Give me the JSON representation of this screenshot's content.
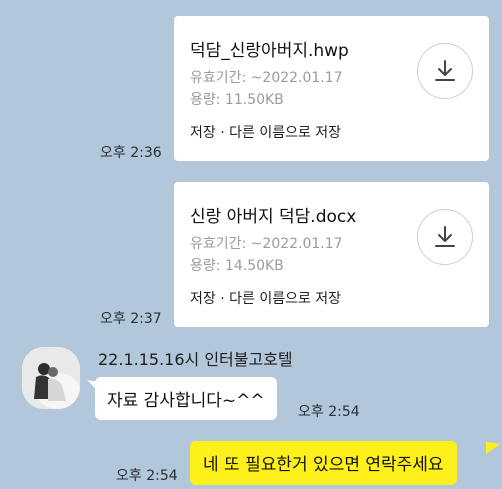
{
  "messages": {
    "file1": {
      "time": "오후 2:36",
      "file_name": "덕담_신랑아버지.hwp",
      "expiry": "유효기간: ~2022.01.17",
      "size": "용량: 11.50KB",
      "actions": "저장 · 다른 이름으로 저장",
      "icon": "download-icon"
    },
    "file2": {
      "time": "오후 2:37",
      "file_name": "신랑 아버지 덕담.docx",
      "expiry": "유효기간: ~2022.01.17",
      "size": "용량: 14.50KB",
      "actions": "저장 · 다른 이름으로 저장",
      "icon": "download-icon"
    },
    "incoming": {
      "sender": "22.1.15.16시 인터불고호텔",
      "text": "자료 감사합니다~^^",
      "time": "오후 2:54"
    },
    "outgoing": {
      "text": "네 또 필요한거 있으면 연락주세요",
      "time": "오후 2:54"
    }
  },
  "colors": {
    "background": "#b2c7da",
    "my_bubble": "#fef01b",
    "their_bubble": "#ffffff"
  }
}
